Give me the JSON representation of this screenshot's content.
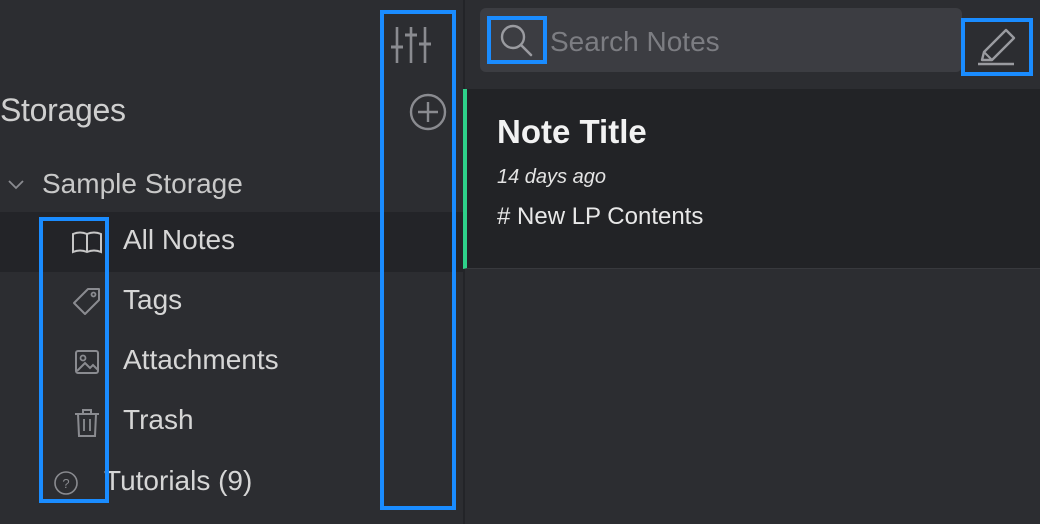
{
  "sidebar": {
    "section_title": "Storages",
    "storage": {
      "label": "Sample Storage",
      "chevron_icon": "chevron-down-icon"
    },
    "items": [
      {
        "label": "All Notes",
        "icon": "book-icon",
        "active": true
      },
      {
        "label": "Tags",
        "icon": "tag-icon",
        "active": false
      },
      {
        "label": "Attachments",
        "icon": "image-icon",
        "active": false
      },
      {
        "label": "Trash",
        "icon": "trash-icon",
        "active": false
      }
    ],
    "tutorials": {
      "label": "Tutorials (9)",
      "icon": "help-circle-icon"
    },
    "tools": {
      "filter_icon": "sliders-icon",
      "add_icon": "add-circle-icon"
    }
  },
  "search": {
    "placeholder": "Search Notes",
    "value": ""
  },
  "toolbar": {
    "compose_icon": "pencil-icon"
  },
  "notes": [
    {
      "title": "Note Title",
      "date": "14 days ago",
      "preview": "# New LP Contents"
    }
  ],
  "colors": {
    "background": "#2c2d31",
    "active_row": "#232428",
    "note_accent": "#2ed18a",
    "highlight_box": "#1a8cff"
  }
}
